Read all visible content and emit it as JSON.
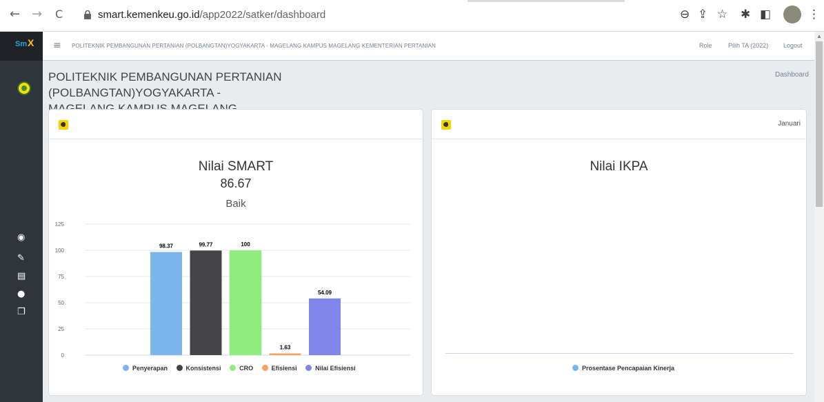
{
  "browser": {
    "url_host": "smart.kemenkeu.go.id",
    "url_path": "/app2022/satker/dashboard",
    "nav_back": "←",
    "nav_forward": "→",
    "reload": "C"
  },
  "sidebar": {
    "logo": "Sm",
    "logo_mark": "X",
    "items": [
      {
        "icon": "dashboard-icon",
        "glyph": "◉"
      },
      {
        "icon": "edit-icon",
        "glyph": "✎"
      },
      {
        "icon": "book-icon",
        "glyph": "▤"
      },
      {
        "icon": "user-icon",
        "glyph": "●"
      },
      {
        "icon": "copy-icon",
        "glyph": "❐"
      }
    ]
  },
  "header": {
    "menu_glyph": "≡",
    "title": "POLITEKNIK PEMBANGUNAN PERTANIAN (POLBANGTAN)YOGYAKARTA - MAGELANG KAMPUS MAGELANG KEMENTERIAN PERTANIAN",
    "role": "Role",
    "pilih_ta": "Pilih TA (2022)",
    "logout": "Logout"
  },
  "page": {
    "heading_line1": "POLITEKNIK PEMBANGUNAN PERTANIAN (POLBANGTAN)YOGYAKARTA -",
    "heading_line2": "MAGELANG KAMPUS MAGELANG",
    "breadcrumb": "Dashboard"
  },
  "smart_card": {
    "title": "Nilai SMART",
    "score": "86.67",
    "rating": "Baik"
  },
  "ikpa_card": {
    "month": "Januari",
    "title": "Nilai IKPA",
    "legend": "Prosentase Pencapaian Kinerja",
    "legend_color": "#7cb5ec"
  },
  "chart_data": [
    {
      "type": "bar",
      "title": "Nilai SMART",
      "categories": [
        "Penyerapan",
        "Konsistensi",
        "CRO",
        "Efisiensi",
        "Nilai Efisiensi"
      ],
      "values": [
        98.37,
        99.77,
        100,
        1.63,
        54.09
      ],
      "value_labels": [
        "98.37",
        "99.77",
        "100",
        "1.63",
        "54.09"
      ],
      "colors": [
        "#7cb5ec",
        "#434348",
        "#90ed7d",
        "#f7a35c",
        "#8085e9"
      ],
      "yticks": [
        "0",
        "25",
        "50",
        "75",
        "100",
        "125"
      ],
      "ylim": [
        0,
        125
      ],
      "grid": true,
      "legend": "bottom"
    },
    {
      "type": "bar",
      "title": "Nilai IKPA",
      "series": [
        {
          "name": "Prosentase Pencapaian Kinerja",
          "values": []
        }
      ],
      "legend": "bottom"
    }
  ]
}
